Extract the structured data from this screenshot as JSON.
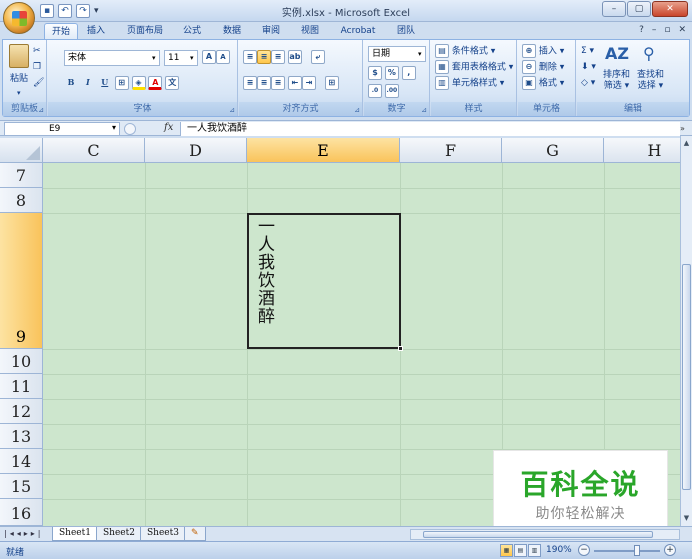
{
  "window": {
    "title": "实例.xlsx - Microsoft Excel"
  },
  "ribbon_tabs": [
    "开始",
    "插入",
    "页面布局",
    "公式",
    "数据",
    "审阅",
    "视图",
    "Acrobat",
    "团队"
  ],
  "active_tab": "开始",
  "clipboard": {
    "paste_label": "粘贴",
    "group_label": "剪贴板"
  },
  "font": {
    "name": "宋体",
    "size": "11",
    "group_label": "字体",
    "bold": "B",
    "italic": "I",
    "underline": "U"
  },
  "alignment": {
    "group_label": "对齐方式"
  },
  "number": {
    "format": "日期",
    "group_label": "数字",
    "percent": "%",
    "comma": ",",
    "inc_decimal": "+.0\n.00",
    "dec_decimal": ".00"
  },
  "styles": {
    "conditional": "条件格式",
    "as_table": "套用表格格式",
    "cell_styles": "单元格样式",
    "group_label": "样式"
  },
  "cells": {
    "insert": "插入",
    "delete": "删除",
    "format": "格式",
    "group_label": "单元格"
  },
  "editing": {
    "sort_filter_1": "排序和",
    "sort_filter_2": "筛选",
    "find_select_1": "查找和",
    "find_select_2": "选择",
    "group_label": "编辑"
  },
  "formula_bar": {
    "name_box": "E9",
    "fx": "fx",
    "content": "一人我饮酒醉"
  },
  "grid": {
    "columns": [
      "C",
      "D",
      "E",
      "F",
      "G",
      "H"
    ],
    "selected_column": "E",
    "rows": [
      "7",
      "8",
      "9",
      "10",
      "11",
      "12",
      "13",
      "14",
      "15",
      "16"
    ],
    "selected_row": "9",
    "active_cell_text": "一人我饮酒醉"
  },
  "sheets": [
    "Sheet1",
    "Sheet2",
    "Sheet3"
  ],
  "active_sheet": "Sheet1",
  "status": {
    "ready": "就绪",
    "zoom": "190%"
  },
  "watermark": {
    "main": "百科全说",
    "sub": "助你轻松解决"
  },
  "colors": {
    "grid_bg": "#cde6cd",
    "selected_header": "#f9c35b",
    "ribbon_text": "#15428b",
    "watermark_green": "#2aa62a"
  }
}
